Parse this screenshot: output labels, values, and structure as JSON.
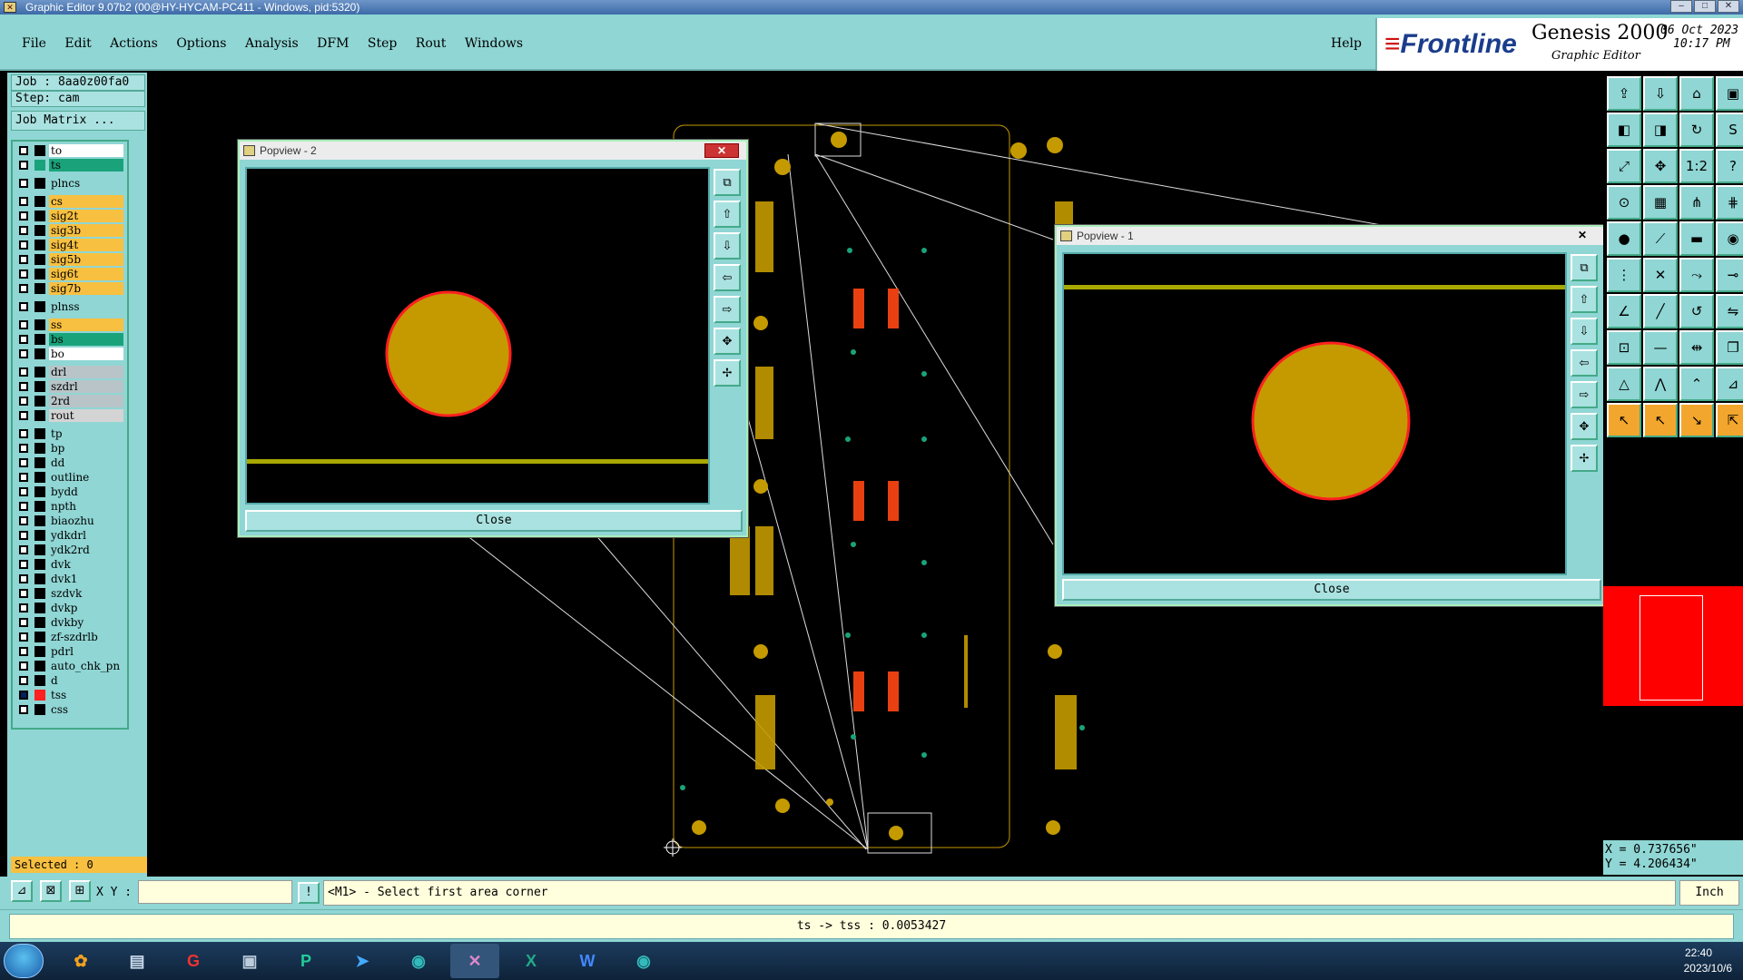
{
  "window": {
    "title": "Graphic Editor 9.07b2 (00@HY-HYCAM-PC411 - Windows, pid:5320)"
  },
  "menu": {
    "items": [
      "File",
      "Edit",
      "Actions",
      "Options",
      "Analysis",
      "DFM",
      "Step",
      "Rout",
      "Windows"
    ],
    "help": "Help"
  },
  "brand": {
    "frontline": "Frontline",
    "product": "Genesis 2000",
    "subtitle": "Graphic Editor",
    "date": "06 Oct 2023",
    "time": "10:17 PM"
  },
  "left": {
    "job": "Job : 8aa0z00fa0",
    "step": "Step: cam",
    "matrix": "Job Matrix ...",
    "selected": "Selected : 0"
  },
  "layers": [
    {
      "name": "to",
      "color": "#ffffff",
      "ind": "#000000"
    },
    {
      "name": "ts",
      "color": "#1aa37a",
      "ind": "#1aa37a"
    },
    {
      "sep": true
    },
    {
      "name": "plncs",
      "color": "#8fd6d4",
      "ind": "#000000"
    },
    {
      "sep": true
    },
    {
      "name": "cs",
      "color": "#f8c040",
      "ind": "#000000"
    },
    {
      "name": "sig2t",
      "color": "#f8c040",
      "ind": "#000000"
    },
    {
      "name": "sig3b",
      "color": "#f8c040",
      "ind": "#000000"
    },
    {
      "name": "sig4t",
      "color": "#f8c040",
      "ind": "#000000"
    },
    {
      "name": "sig5b",
      "color": "#f8c040",
      "ind": "#000000"
    },
    {
      "name": "sig6t",
      "color": "#f8c040",
      "ind": "#000000"
    },
    {
      "name": "sig7b",
      "color": "#f8c040",
      "ind": "#000000"
    },
    {
      "sep": true
    },
    {
      "name": "plnss",
      "color": "#8fd6d4",
      "ind": "#000000"
    },
    {
      "sep": true
    },
    {
      "name": "ss",
      "color": "#f8c040",
      "ind": "#000000"
    },
    {
      "name": "bs",
      "color": "#1aa37a",
      "ind": "#000000"
    },
    {
      "name": "bo",
      "color": "#ffffff",
      "ind": "#000000"
    },
    {
      "sep": true
    },
    {
      "name": "drl",
      "color": "#b8c4c8",
      "ind": "#000000"
    },
    {
      "name": "szdrl",
      "color": "#b8c4c8",
      "ind": "#000000"
    },
    {
      "name": "2rd",
      "color": "#b8c4c8",
      "ind": "#000000"
    },
    {
      "name": "rout",
      "color": "#d4d4d4",
      "ind": "#000000"
    },
    {
      "sep": true
    },
    {
      "name": "tp",
      "color": "#8fd6d4",
      "ind": "#000000"
    },
    {
      "name": "bp",
      "color": "#8fd6d4",
      "ind": "#000000"
    },
    {
      "name": "dd",
      "color": "#8fd6d4",
      "ind": "#000000"
    },
    {
      "name": "outline",
      "color": "#8fd6d4",
      "ind": "#000000"
    },
    {
      "name": "bydd",
      "color": "#8fd6d4",
      "ind": "#000000"
    },
    {
      "name": "npth",
      "color": "#8fd6d4",
      "ind": "#000000"
    },
    {
      "name": "biaozhu",
      "color": "#8fd6d4",
      "ind": "#000000"
    },
    {
      "name": "ydkdrl",
      "color": "#8fd6d4",
      "ind": "#000000"
    },
    {
      "name": "ydk2rd",
      "color": "#8fd6d4",
      "ind": "#000000"
    },
    {
      "name": "dvk",
      "color": "#8fd6d4",
      "ind": "#000000"
    },
    {
      "name": "dvk1",
      "color": "#8fd6d4",
      "ind": "#000000"
    },
    {
      "name": "szdvk",
      "color": "#8fd6d4",
      "ind": "#000000"
    },
    {
      "name": "dvkp",
      "color": "#8fd6d4",
      "ind": "#000000"
    },
    {
      "name": "dvkby",
      "color": "#8fd6d4",
      "ind": "#000000"
    },
    {
      "name": "zf-szdrlb",
      "color": "#8fd6d4",
      "ind": "#000000"
    },
    {
      "name": "pdrl",
      "color": "#8fd6d4",
      "ind": "#000000"
    },
    {
      "name": "auto_chk_pn",
      "color": "#8fd6d4",
      "ind": "#000000"
    },
    {
      "name": "d",
      "color": "#8fd6d4",
      "ind": "#000000"
    },
    {
      "name": "tss",
      "color": "#8fd6d4",
      "ind": "#ff2020",
      "checked": true
    },
    {
      "name": "css",
      "color": "#8fd6d4",
      "ind": "#000000"
    }
  ],
  "popview2": {
    "title": "Popview - 2",
    "close": "Close",
    "close_x": "✕"
  },
  "popview1": {
    "title": "Popview - 1",
    "close": "Close",
    "close_x": "✕"
  },
  "right": {
    "x": "X = 0.737656\"",
    "y": "Y = 4.206434\""
  },
  "bottom": {
    "xy_label": "X Y :",
    "xy_value": "",
    "prompt": "<M1> - Select first area corner",
    "units": "Inch"
  },
  "status": {
    "text": "ts -> tss : 0.0053427"
  },
  "tray": {
    "time": "22:40",
    "date": "2023/10/6"
  },
  "colors": {
    "teal": "#8fd6d4",
    "pad": "#c49a00",
    "outline": "#ff2020",
    "green": "#1aa37a"
  }
}
